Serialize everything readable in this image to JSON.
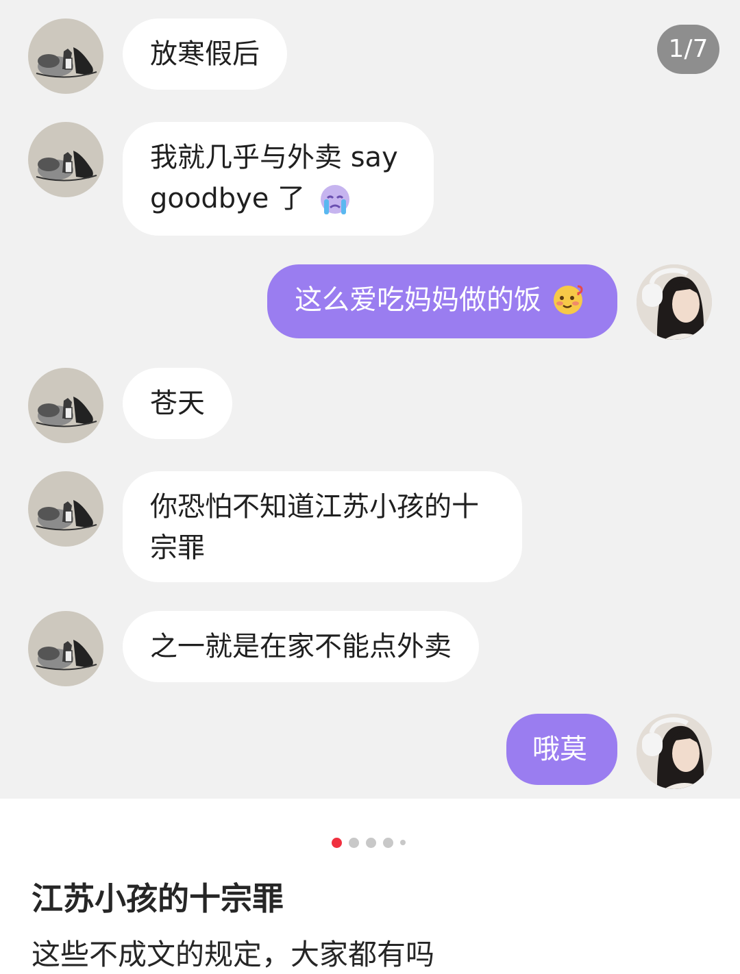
{
  "counter": "1/7",
  "messages": [
    {
      "text": "放寒假后"
    },
    {
      "line1": "我就几乎与外卖 say",
      "line2": "goodbye 了"
    },
    {
      "text": "这么爱吃妈妈做的饭"
    },
    {
      "text": "苍天"
    },
    {
      "line1": "你恐怕不知道江苏小孩的十",
      "line2": "宗罪"
    },
    {
      "text": "之一就是在家不能点外卖"
    },
    {
      "text": "哦莫"
    }
  ],
  "pager": {
    "total_visible": 5,
    "active_index": 0
  },
  "post": {
    "title": "江苏小孩的十宗罪",
    "description": "这些不成文的规定，大家都有吗"
  },
  "colors": {
    "self_bubble": "#9a7df0",
    "other_bubble": "#ffffff",
    "chat_bg": "#f1f1f1",
    "active_dot": "#f0303f"
  },
  "icons": [
    "crying-face-emoji",
    "smiling-blush-emoji"
  ]
}
